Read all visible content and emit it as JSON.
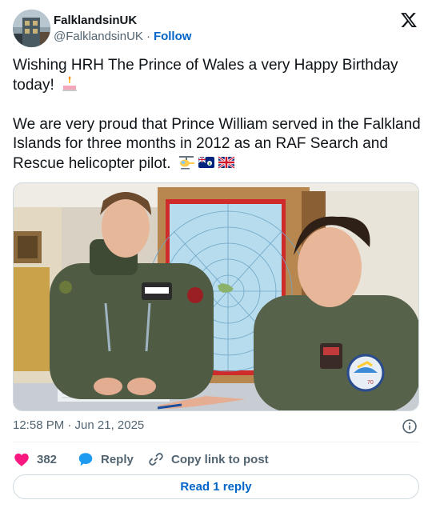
{
  "author": {
    "name": "FalklandsinUK",
    "handle": "@FalklandsinUK",
    "separator": "·",
    "follow_label": "Follow"
  },
  "tweet": {
    "paragraph1": "Wishing HRH The Prince of Wales a very Happy Birthday today!",
    "paragraph2": "We are very proud that Prince William served in the Falkland Islands for three months in 2012 as an RAF Search and Rescue helicopter pilot.",
    "emojis_p1": [
      "birthday-cake"
    ],
    "emojis_p2": [
      "helicopter",
      "falkland-islands-flag",
      "union-jack-flag"
    ]
  },
  "photo": {
    "description_icon": "photo-image",
    "patch_number": "70"
  },
  "meta": {
    "timestamp": "12:58 PM · Jun 21, 2025"
  },
  "actions": {
    "like_count": "382",
    "reply_label": "Reply",
    "copy_label": "Copy link to post"
  },
  "footer": {
    "read_replies_label": "Read 1 reply"
  },
  "colors": {
    "link_blue": "#0064c8",
    "like_red": "#f91880",
    "reply_blue": "#1d9bf0",
    "muted": "#536471",
    "text": "#0f1419"
  }
}
